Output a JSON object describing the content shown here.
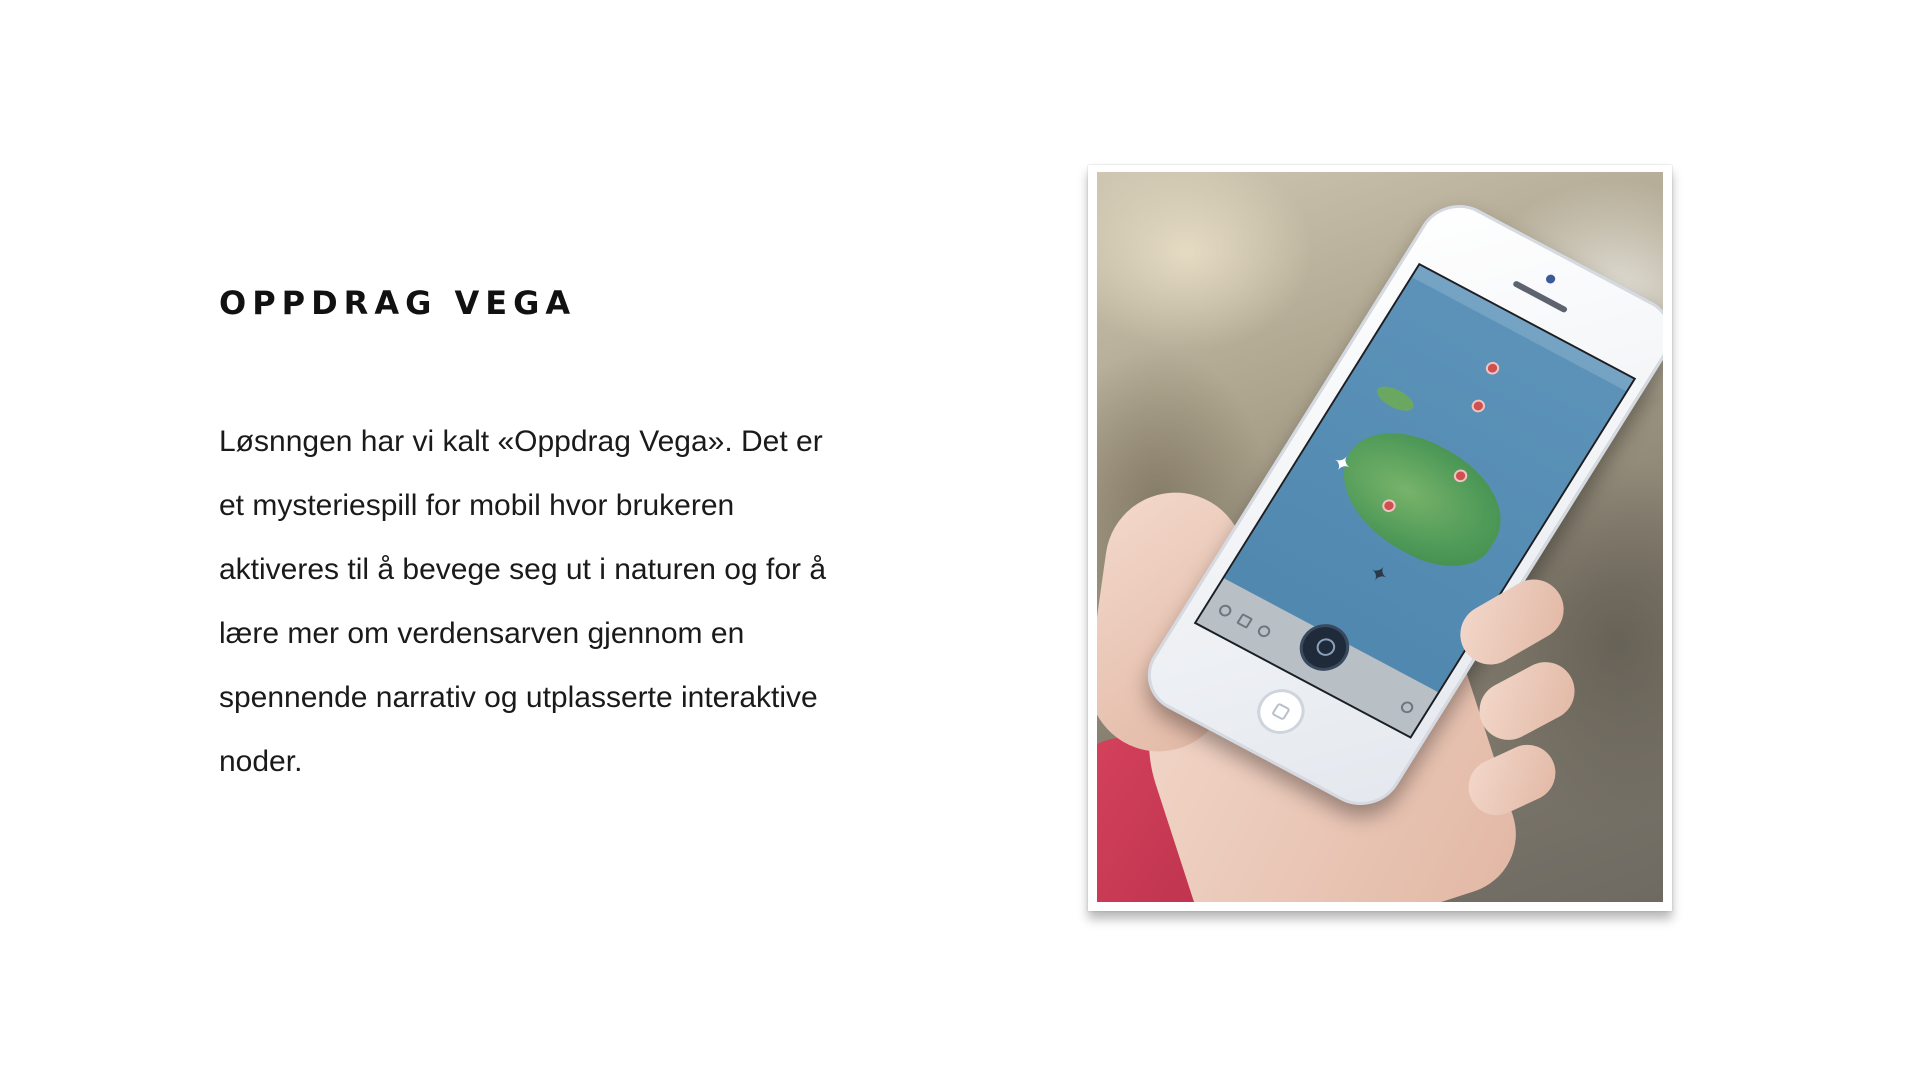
{
  "slide": {
    "title": "OPPDRAG VEGA",
    "body_lines": [
      "Løsnngen har vi kalt «Oppdrag Vega». Det er",
      "et mysteriespill for mobil hvor brukeren",
      "aktiveres til å bevege seg ut i naturen og for å",
      "lære mer om verdensarven gjennom en",
      "spennende narrativ og utplasserte interaktive",
      "noder."
    ]
  },
  "photo": {
    "subject": "hand holding white smartphone showing map app",
    "colors": {
      "map_water": "#5d93b9",
      "map_land": "#4f9a58",
      "sleeve": "#d8445e",
      "phone_body": "#ffffff"
    },
    "icons": [
      "map-pin-icon",
      "bird-icon",
      "search-icon",
      "home-button-icon"
    ]
  }
}
